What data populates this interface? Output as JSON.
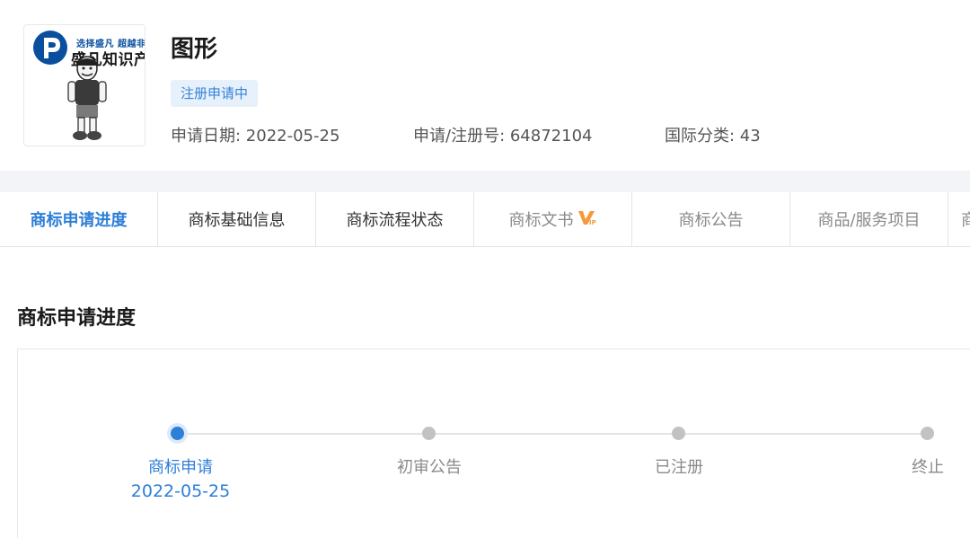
{
  "header": {
    "logo": {
      "tagline": "选择盛凡  超越非凡",
      "name": "盛凡知识产权"
    },
    "title": "图形",
    "status_badge": "注册申请中",
    "meta": {
      "date_label": "申请日期: ",
      "date_value": "2022-05-25",
      "reg_label": "申请/注册号: ",
      "reg_value": "64872104",
      "class_label": "国际分类: ",
      "class_value": "43"
    }
  },
  "tabs": [
    {
      "label": "商标申请进度",
      "active": true
    },
    {
      "label": "商标基础信息"
    },
    {
      "label": "商标流程状态"
    },
    {
      "label": "商标文书",
      "vip_icon": "vip-icon"
    },
    {
      "label": "商标公告"
    },
    {
      "label": "商品/服务项目"
    },
    {
      "label": "商"
    }
  ],
  "section": {
    "title": "商标申请进度",
    "steps": [
      {
        "label": "商标申请",
        "date": "2022-05-25",
        "active": true
      },
      {
        "label": "初审公告"
      },
      {
        "label": "已注册"
      },
      {
        "label": "终止"
      }
    ]
  },
  "colors": {
    "accent": "#2e7fd8",
    "badge_bg": "#e6f1fb",
    "inactive_dot": "#c2c2c2",
    "logo_blue": "#0a4f9e"
  }
}
